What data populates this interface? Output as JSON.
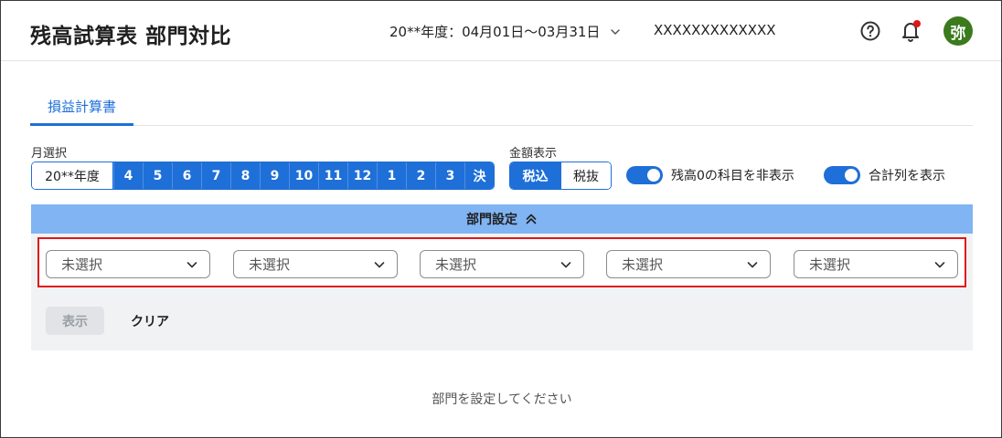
{
  "header": {
    "title": "残高試算表 部門対比",
    "period": "20**年度：04月01日〜03月31日",
    "company": "XXXXXXXXXXXXX",
    "avatar_text": "弥",
    "help_icon": "question-circle-icon",
    "bell_icon": "bell-icon",
    "avatar_color": "#3b7a1d",
    "notification_dot_color": "#e0161a"
  },
  "tabs": [
    {
      "label": "損益計算書",
      "active": true
    }
  ],
  "month_select": {
    "label": "月選択",
    "year_label": "20**年度",
    "months": [
      "4",
      "5",
      "6",
      "7",
      "8",
      "9",
      "10",
      "11",
      "12",
      "1",
      "2",
      "3",
      "決"
    ]
  },
  "amount_display": {
    "label": "金額表示",
    "options": [
      "税込",
      "税抜"
    ],
    "selected": "税込"
  },
  "toggles": [
    {
      "label": "残高0の科目を非表示",
      "on": true
    },
    {
      "label": "合計列を表示",
      "on": true
    }
  ],
  "department": {
    "bar_label": "部門設定",
    "selects": [
      "未選択",
      "未選択",
      "未選択",
      "未選択",
      "未選択"
    ],
    "show_label": "表示",
    "clear_label": "クリア",
    "empty_message": "部門を設定してください"
  },
  "colors": {
    "accent": "#1e6fd8",
    "dept_bar": "#80b4f3",
    "highlight_border": "#e0161a"
  }
}
